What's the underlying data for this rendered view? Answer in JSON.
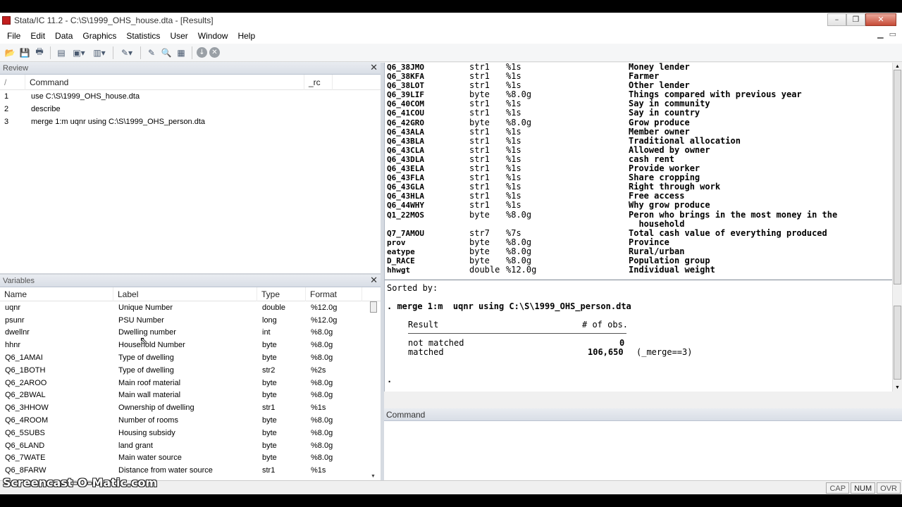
{
  "window": {
    "title": "Stata/IC 11.2 - C:\\S\\1999_OHS_house.dta - [Results]",
    "buttons": [
      "–",
      "❐",
      "✕"
    ]
  },
  "menubar": {
    "items": [
      "File",
      "Edit",
      "Data",
      "Graphics",
      "Statistics",
      "User",
      "Window",
      "Help"
    ]
  },
  "review": {
    "title": "Review",
    "columns": [
      "/",
      "Command",
      "_rc"
    ],
    "rows": [
      {
        "n": "1",
        "cmd": "use C:\\S\\1999_OHS_house.dta"
      },
      {
        "n": "2",
        "cmd": "describe"
      },
      {
        "n": "3",
        "cmd": "merge 1:m  uqnr using C:\\S\\1999_OHS_person.dta"
      }
    ]
  },
  "variables": {
    "title": "Variables",
    "columns": [
      "Name",
      "Label",
      "Type",
      "Format"
    ],
    "rows": [
      {
        "name": "uqnr",
        "label": "Unique Number",
        "type": "double",
        "format": "%12.0g"
      },
      {
        "name": "psunr",
        "label": "PSU Number",
        "type": "long",
        "format": "%12.0g"
      },
      {
        "name": "dwellnr",
        "label": "Dwelling number",
        "type": "int",
        "format": "%8.0g"
      },
      {
        "name": "hhnr",
        "label": "Household Number",
        "type": "byte",
        "format": "%8.0g"
      },
      {
        "name": "Q6_1AMAI",
        "label": "Type of dwelling",
        "type": "byte",
        "format": "%8.0g"
      },
      {
        "name": "Q6_1BOTH",
        "label": "Type of dwelling",
        "type": "str2",
        "format": "%2s"
      },
      {
        "name": "Q6_2AROO",
        "label": "Main roof material",
        "type": "byte",
        "format": "%8.0g"
      },
      {
        "name": "Q6_2BWAL",
        "label": "Main wall material",
        "type": "byte",
        "format": "%8.0g"
      },
      {
        "name": "Q6_3HHOW",
        "label": "Ownership of dwelling",
        "type": "str1",
        "format": "%1s"
      },
      {
        "name": "Q6_4ROOM",
        "label": "Number of rooms",
        "type": "byte",
        "format": "%8.0g"
      },
      {
        "name": "Q6_5SUBS",
        "label": "Housing subsidy",
        "type": "byte",
        "format": "%8.0g"
      },
      {
        "name": "Q6_6LAND",
        "label": "land grant",
        "type": "byte",
        "format": "%8.0g"
      },
      {
        "name": "Q6_7WATE",
        "label": "Main water source",
        "type": "byte",
        "format": "%8.0g"
      },
      {
        "name": "Q6_8FARW",
        "label": "Distance from water source",
        "type": "str1",
        "format": "%1s"
      }
    ]
  },
  "results": {
    "describe_rows": [
      {
        "name": "Q6_38JMO",
        "type": "str1",
        "fmt": "%1s",
        "label": "Money lender"
      },
      {
        "name": "Q6_38KFA",
        "type": "str1",
        "fmt": "%1s",
        "label": "Farmer"
      },
      {
        "name": "Q6_38LOT",
        "type": "str1",
        "fmt": "%1s",
        "label": "Other lender"
      },
      {
        "name": "Q6_39LIF",
        "type": "byte",
        "fmt": "%8.0g",
        "label": "Things compared with previous year"
      },
      {
        "name": "Q6_40COM",
        "type": "str1",
        "fmt": "%1s",
        "label": "Say in community"
      },
      {
        "name": "Q6_41COU",
        "type": "str1",
        "fmt": "%1s",
        "label": "Say in country"
      },
      {
        "name": "Q6_42GRO",
        "type": "byte",
        "fmt": "%8.0g",
        "label": "Grow produce"
      },
      {
        "name": "Q6_43ALA",
        "type": "str1",
        "fmt": "%1s",
        "label": "Member owner"
      },
      {
        "name": "Q6_43BLA",
        "type": "str1",
        "fmt": "%1s",
        "label": "Traditional allocation"
      },
      {
        "name": "Q6_43CLA",
        "type": "str1",
        "fmt": "%1s",
        "label": "Allowed by owner"
      },
      {
        "name": "Q6_43DLA",
        "type": "str1",
        "fmt": "%1s",
        "label": "cash rent"
      },
      {
        "name": "Q6_43ELA",
        "type": "str1",
        "fmt": "%1s",
        "label": "Provide worker"
      },
      {
        "name": "Q6_43FLA",
        "type": "str1",
        "fmt": "%1s",
        "label": "Share cropping"
      },
      {
        "name": "Q6_43GLA",
        "type": "str1",
        "fmt": "%1s",
        "label": "Right through work"
      },
      {
        "name": "Q6_43HLA",
        "type": "str1",
        "fmt": "%1s",
        "label": "Free access"
      },
      {
        "name": "Q6_44WHY",
        "type": "str1",
        "fmt": "%1s",
        "label": "Why grow produce"
      },
      {
        "name": "Q1_22MOS",
        "type": "byte",
        "fmt": "%8.0g",
        "label": "Peron who brings in the most money in the"
      },
      {
        "name": "",
        "type": "",
        "fmt": "",
        "label": "  household"
      },
      {
        "name": "Q7_7AMOU",
        "type": "str7",
        "fmt": "%7s",
        "label": "Total cash value of everything produced"
      },
      {
        "name": "prov",
        "type": "byte",
        "fmt": "%8.0g",
        "label": "Province"
      },
      {
        "name": "eatype",
        "type": "byte",
        "fmt": "%8.0g",
        "label": "Rural/urban"
      },
      {
        "name": "D_RACE",
        "type": "byte",
        "fmt": "%8.0g",
        "label": "Population group"
      },
      {
        "name": "hhwgt",
        "type": "double",
        "fmt": "%12.0g",
        "label": "Individual weight"
      }
    ],
    "sorted_by": "Sorted by:",
    "command_line": ". merge 1:m  uqnr using C:\\S\\1999_OHS_person.dta",
    "merge_header_result": "Result",
    "merge_header_obs": "# of obs.",
    "not_matched_label": "not matched",
    "not_matched_value": "0",
    "matched_label": "matched",
    "matched_value": "106,650",
    "matched_note": "(_merge==3)",
    "prompt": "."
  },
  "command_panel": {
    "title": "Command"
  },
  "statusbar": {
    "items": [
      "CAP",
      "NUM",
      "OVR"
    ]
  },
  "watermark": "Screencast-O-Matic.com"
}
